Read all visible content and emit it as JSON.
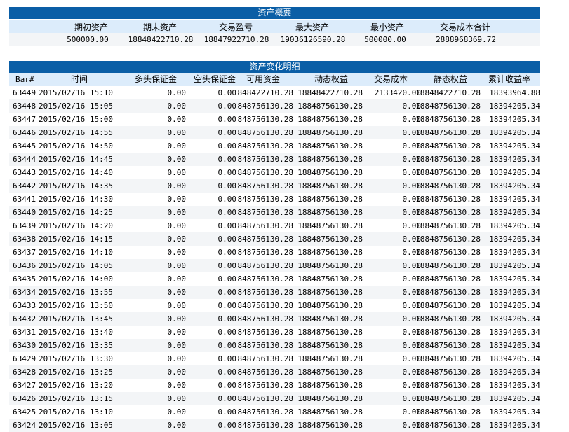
{
  "summary": {
    "title": "资产概要",
    "headers": [
      "期初资产",
      "期末资产",
      "交易盈亏",
      "最大资产",
      "最小资产",
      "交易成本合计"
    ],
    "values": [
      "500000.00",
      "18848422710.28",
      "18847922710.28",
      "19036126590.28",
      "500000.00",
      "2888968369.72"
    ]
  },
  "detail": {
    "title": "资产变化明细",
    "headers": [
      "Bar#",
      "时间",
      "多头保证金",
      "空头保证金",
      "可用资金",
      "动态权益",
      "交易成本",
      "静态权益",
      "累计收益率"
    ],
    "rows": [
      [
        "63449",
        "2015/02/16 15:10",
        "0.00",
        "0.00",
        "18848422710.28",
        "18848422710.28",
        "2133420.00",
        "18848422710.28",
        "18393964.88"
      ],
      [
        "63448",
        "2015/02/16 15:05",
        "0.00",
        "0.00",
        "18848756130.28",
        "18848756130.28",
        "0.00",
        "18848756130.28",
        "18394205.34"
      ],
      [
        "63447",
        "2015/02/16 15:00",
        "0.00",
        "0.00",
        "18848756130.28",
        "18848756130.28",
        "0.00",
        "18848756130.28",
        "18394205.34"
      ],
      [
        "63446",
        "2015/02/16 14:55",
        "0.00",
        "0.00",
        "18848756130.28",
        "18848756130.28",
        "0.00",
        "18848756130.28",
        "18394205.34"
      ],
      [
        "63445",
        "2015/02/16 14:50",
        "0.00",
        "0.00",
        "18848756130.28",
        "18848756130.28",
        "0.00",
        "18848756130.28",
        "18394205.34"
      ],
      [
        "63444",
        "2015/02/16 14:45",
        "0.00",
        "0.00",
        "18848756130.28",
        "18848756130.28",
        "0.00",
        "18848756130.28",
        "18394205.34"
      ],
      [
        "63443",
        "2015/02/16 14:40",
        "0.00",
        "0.00",
        "18848756130.28",
        "18848756130.28",
        "0.00",
        "18848756130.28",
        "18394205.34"
      ],
      [
        "63442",
        "2015/02/16 14:35",
        "0.00",
        "0.00",
        "18848756130.28",
        "18848756130.28",
        "0.00",
        "18848756130.28",
        "18394205.34"
      ],
      [
        "63441",
        "2015/02/16 14:30",
        "0.00",
        "0.00",
        "18848756130.28",
        "18848756130.28",
        "0.00",
        "18848756130.28",
        "18394205.34"
      ],
      [
        "63440",
        "2015/02/16 14:25",
        "0.00",
        "0.00",
        "18848756130.28",
        "18848756130.28",
        "0.00",
        "18848756130.28",
        "18394205.34"
      ],
      [
        "63439",
        "2015/02/16 14:20",
        "0.00",
        "0.00",
        "18848756130.28",
        "18848756130.28",
        "0.00",
        "18848756130.28",
        "18394205.34"
      ],
      [
        "63438",
        "2015/02/16 14:15",
        "0.00",
        "0.00",
        "18848756130.28",
        "18848756130.28",
        "0.00",
        "18848756130.28",
        "18394205.34"
      ],
      [
        "63437",
        "2015/02/16 14:10",
        "0.00",
        "0.00",
        "18848756130.28",
        "18848756130.28",
        "0.00",
        "18848756130.28",
        "18394205.34"
      ],
      [
        "63436",
        "2015/02/16 14:05",
        "0.00",
        "0.00",
        "18848756130.28",
        "18848756130.28",
        "0.00",
        "18848756130.28",
        "18394205.34"
      ],
      [
        "63435",
        "2015/02/16 14:00",
        "0.00",
        "0.00",
        "18848756130.28",
        "18848756130.28",
        "0.00",
        "18848756130.28",
        "18394205.34"
      ],
      [
        "63434",
        "2015/02/16 13:55",
        "0.00",
        "0.00",
        "18848756130.28",
        "18848756130.28",
        "0.00",
        "18848756130.28",
        "18394205.34"
      ],
      [
        "63433",
        "2015/02/16 13:50",
        "0.00",
        "0.00",
        "18848756130.28",
        "18848756130.28",
        "0.00",
        "18848756130.28",
        "18394205.34"
      ],
      [
        "63432",
        "2015/02/16 13:45",
        "0.00",
        "0.00",
        "18848756130.28",
        "18848756130.28",
        "0.00",
        "18848756130.28",
        "18394205.34"
      ],
      [
        "63431",
        "2015/02/16 13:40",
        "0.00",
        "0.00",
        "18848756130.28",
        "18848756130.28",
        "0.00",
        "18848756130.28",
        "18394205.34"
      ],
      [
        "63430",
        "2015/02/16 13:35",
        "0.00",
        "0.00",
        "18848756130.28",
        "18848756130.28",
        "0.00",
        "18848756130.28",
        "18394205.34"
      ],
      [
        "63429",
        "2015/02/16 13:30",
        "0.00",
        "0.00",
        "18848756130.28",
        "18848756130.28",
        "0.00",
        "18848756130.28",
        "18394205.34"
      ],
      [
        "63428",
        "2015/02/16 13:25",
        "0.00",
        "0.00",
        "18848756130.28",
        "18848756130.28",
        "0.00",
        "18848756130.28",
        "18394205.34"
      ],
      [
        "63427",
        "2015/02/16 13:20",
        "0.00",
        "0.00",
        "18848756130.28",
        "18848756130.28",
        "0.00",
        "18848756130.28",
        "18394205.34"
      ],
      [
        "63426",
        "2015/02/16 13:15",
        "0.00",
        "0.00",
        "18848756130.28",
        "18848756130.28",
        "0.00",
        "18848756130.28",
        "18394205.34"
      ],
      [
        "63425",
        "2015/02/16 13:10",
        "0.00",
        "0.00",
        "18848756130.28",
        "18848756130.28",
        "0.00",
        "18848756130.28",
        "18394205.34"
      ],
      [
        "63424",
        "2015/02/16 13:05",
        "0.00",
        "0.00",
        "18848756130.28",
        "18848756130.28",
        "0.00",
        "18848756130.28",
        "18394205.34"
      ]
    ]
  }
}
